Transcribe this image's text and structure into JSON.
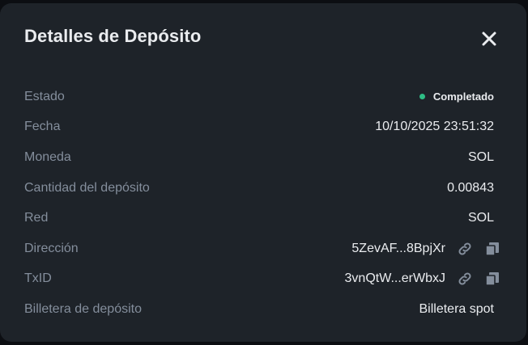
{
  "modal": {
    "title": "Detalles de Depósito",
    "close_icon": "close-icon"
  },
  "details": {
    "estado": {
      "label": "Estado",
      "value": "Completado",
      "status_color": "#2ebd85"
    },
    "fecha": {
      "label": "Fecha",
      "value": "10/10/2025 23:51:32"
    },
    "moneda": {
      "label": "Moneda",
      "value": "SOL"
    },
    "cantidad": {
      "label": "Cantidad del depósito",
      "value": "0.00843"
    },
    "red": {
      "label": "Red",
      "value": "SOL"
    },
    "direccion": {
      "label": "Dirección",
      "value": "5ZevAF...8BpjXr",
      "icons": [
        "link-icon",
        "copy-icon"
      ]
    },
    "txid": {
      "label": "TxID",
      "value": "3vnQtW...erWbxJ",
      "icons": [
        "link-icon",
        "copy-icon"
      ]
    },
    "billetera": {
      "label": "Billetera de depósito",
      "value": "Billetera spot"
    }
  },
  "colors": {
    "background": "#1e2329",
    "label": "#848e9c",
    "text": "#eaecef",
    "success": "#2ebd85"
  }
}
